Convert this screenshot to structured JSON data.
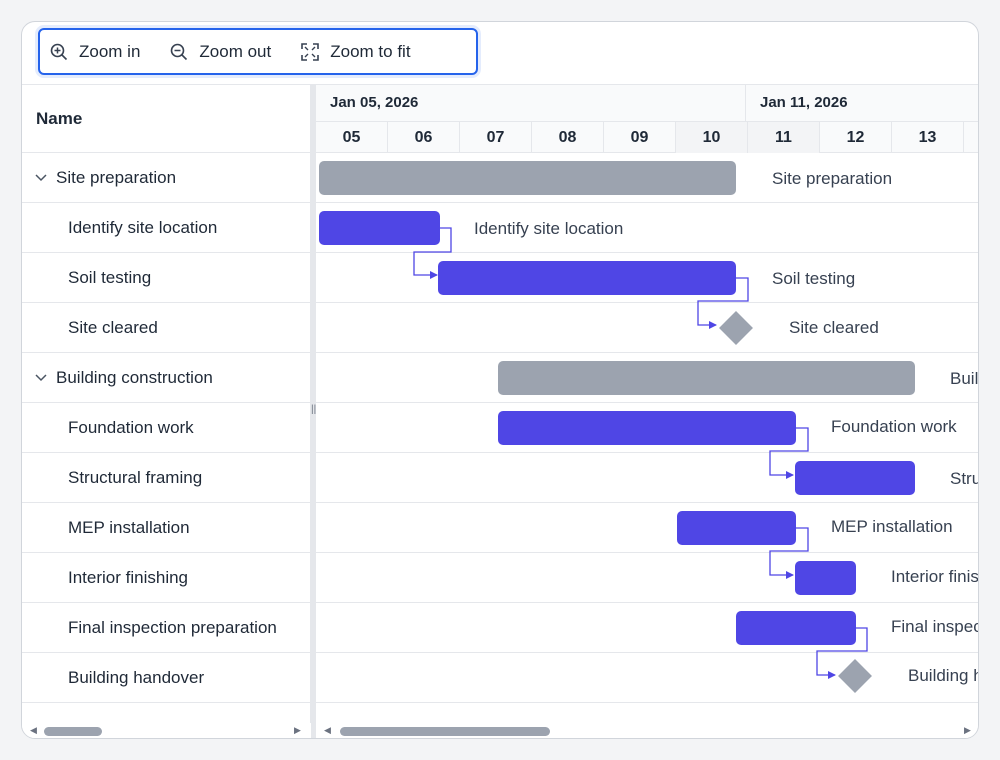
{
  "toolbar": {
    "zoom_in": "Zoom in",
    "zoom_out": "Zoom out",
    "zoom_fit": "Zoom to fit"
  },
  "grid": {
    "name_header": "Name"
  },
  "timeline": {
    "weeks": [
      "Jan 05, 2026",
      "Jan 11, 2026"
    ],
    "days": [
      "05",
      "06",
      "07",
      "08",
      "09",
      "10",
      "11",
      "12",
      "13"
    ]
  },
  "tasks": [
    {
      "name": "Site preparation",
      "type": "summary"
    },
    {
      "name": "Identify site location",
      "type": "task"
    },
    {
      "name": "Soil testing",
      "type": "task"
    },
    {
      "name": "Site cleared",
      "type": "milestone"
    },
    {
      "name": "Building construction",
      "type": "summary"
    },
    {
      "name": "Foundation work",
      "type": "task"
    },
    {
      "name": "Structural framing",
      "type": "task"
    },
    {
      "name": "MEP installation",
      "type": "task"
    },
    {
      "name": "Interior finishing",
      "type": "task"
    },
    {
      "name": "Final inspection preparation",
      "type": "task"
    },
    {
      "name": "Building handover",
      "type": "milestone"
    }
  ],
  "colors": {
    "task_bar": "#4f46e5",
    "summary_bar": "#9ca3af",
    "milestone": "#9ca3af",
    "toolbar_focus": "#2563eb"
  }
}
